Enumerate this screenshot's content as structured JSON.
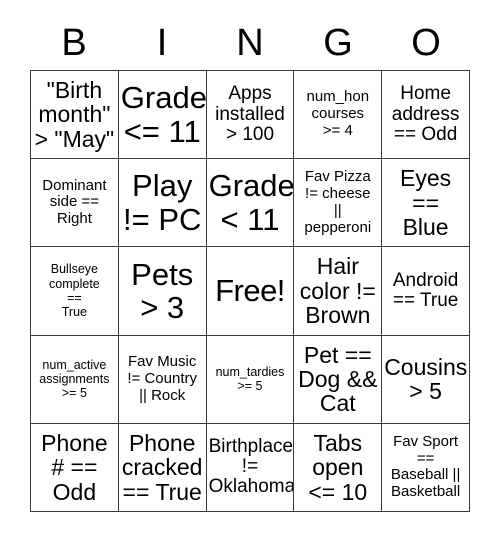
{
  "card": {
    "title_letters": [
      "B",
      "I",
      "N",
      "G",
      "O"
    ],
    "columns": 5,
    "rows": 5,
    "border_color": "#3c3c3c",
    "background_color": "#ffffff",
    "text_color": "#000000"
  },
  "cells": [
    {
      "id": "b1",
      "text": "\"Birth\nmonth\"\n> \"May\"",
      "size": "lg"
    },
    {
      "id": "i1",
      "text": "Grade\n<= 11",
      "size": "xl"
    },
    {
      "id": "n1",
      "text": "Apps\ninstalled\n> 100",
      "size": "md"
    },
    {
      "id": "g1",
      "text": "num_hon\ncourses\n>= 4",
      "size": "sm"
    },
    {
      "id": "o1",
      "text": "Home\naddress\n== Odd",
      "size": "md"
    },
    {
      "id": "b2",
      "text": "Dominant\nside ==\nRight",
      "size": "sm"
    },
    {
      "id": "i2",
      "text": "Play\n!= PC",
      "size": "xl"
    },
    {
      "id": "n2",
      "text": "Grade\n< 11",
      "size": "xl"
    },
    {
      "id": "g2",
      "text": "Fav Pizza\n!= cheese\n||\npepperoni",
      "size": "sm"
    },
    {
      "id": "o2",
      "text": "Eyes\n==\nBlue",
      "size": "lg"
    },
    {
      "id": "b3",
      "text": "Bullseye\ncomplete\n==\nTrue",
      "size": "xs"
    },
    {
      "id": "i3",
      "text": "Pets\n> 3",
      "size": "xl"
    },
    {
      "id": "n3",
      "text": "Free!",
      "size": "xl"
    },
    {
      "id": "g3",
      "text": "Hair\ncolor !=\nBrown",
      "size": "lg"
    },
    {
      "id": "o3",
      "text": "Android\n== True",
      "size": "md"
    },
    {
      "id": "b4",
      "text": "num_active\nassignments\n>= 5",
      "size": "xs"
    },
    {
      "id": "i4",
      "text": "Fav Music\n!= Country\n|| Rock",
      "size": "sm"
    },
    {
      "id": "n4",
      "text": "num_tardies\n>= 5",
      "size": "xs"
    },
    {
      "id": "g4",
      "text": "Pet ==\nDog &&\nCat",
      "size": "lg"
    },
    {
      "id": "o4",
      "text": "Cousins\n> 5",
      "size": "lg"
    },
    {
      "id": "b5",
      "text": "Phone\n# ==\nOdd",
      "size": "lg"
    },
    {
      "id": "i5",
      "text": "Phone\ncracked\n== True",
      "size": "lg"
    },
    {
      "id": "n5",
      "text": "Birthplace\n!=\nOklahoma",
      "size": "md"
    },
    {
      "id": "g5",
      "text": "Tabs\nopen\n<= 10",
      "size": "lg"
    },
    {
      "id": "o5",
      "text": "Fav Sport\n==\nBaseball ||\nBasketball",
      "size": "sm"
    }
  ]
}
